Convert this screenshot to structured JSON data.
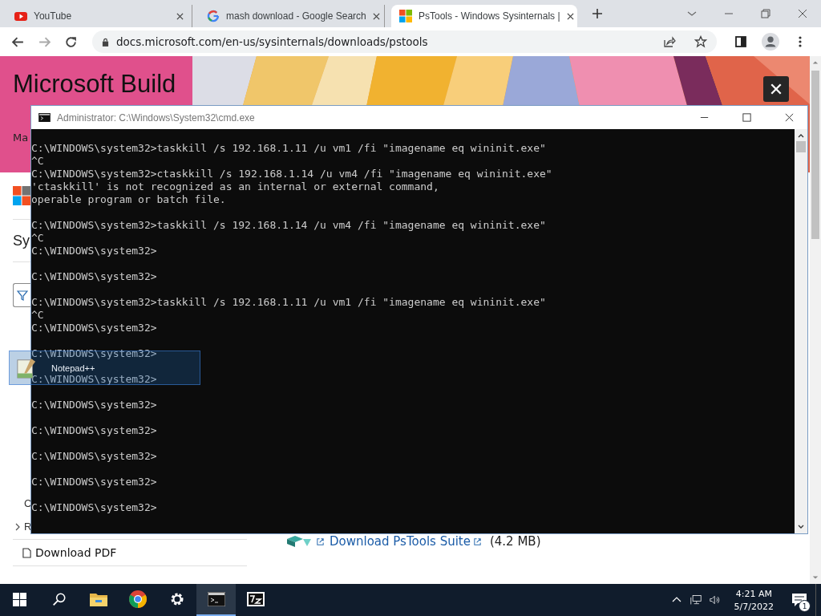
{
  "browser": {
    "tabs": [
      {
        "title": "YouTube",
        "kind": "video",
        "selected": false
      },
      {
        "title": "mash download - Google Search",
        "kind": "search",
        "selected": false
      },
      {
        "title": "PsTools - Windows Sysinternals |",
        "kind": "docs",
        "selected": true
      }
    ],
    "url": "docs.microsoft.com/en-us/sysinternals/downloads/pstools"
  },
  "page": {
    "banner": {
      "title": "Microsoft Build",
      "subtitle": "Ma"
    },
    "sidebar": {
      "heading": "Sy",
      "items": [
        {
          "label": "C",
          "kind": "plain"
        },
        {
          "label": "R",
          "kind": "expandable"
        }
      ],
      "pdf_link": "Download PDF"
    },
    "download": {
      "link": "Download PsTools Suite",
      "size": "(4.2 MB)"
    }
  },
  "console": {
    "title": "Administrator: C:\\Windows\\System32\\cmd.exe",
    "blocks": [
      [
        "C:\\WINDOWS\\system32>taskkill /s 192.168.1.11 /u vm1 /fi \"imagename eq wininit.exe\"",
        "^C",
        "C:\\WINDOWS\\system32>ctaskkill /s 192.168.1.14 /u vm4 /fi \"imagename eq wininit.exe\"",
        "'ctaskkill' is not recognized as an internal or external command,",
        "operable program or batch file."
      ],
      [
        "C:\\WINDOWS\\system32>taskkill /s 192.168.1.14 /u vm4 /fi \"imagename eq wininit.exe\"",
        "^C",
        "C:\\WINDOWS\\system32>"
      ],
      [
        "C:\\WINDOWS\\system32>"
      ],
      [
        "C:\\WINDOWS\\system32>taskkill /s 192.168.1.11 /u vm1 /fi \"imagename eq wininit.exe\"",
        "^C",
        "C:\\WINDOWS\\system32>"
      ],
      [
        "C:\\WINDOWS\\system32>"
      ],
      [
        "C:\\WINDOWS\\system32>"
      ],
      [
        "C:\\WINDOWS\\system32>"
      ],
      [
        "C:\\WINDOWS\\system32>"
      ],
      [
        "C:\\WINDOWS\\system32>"
      ],
      [
        "C:\\WINDOWS\\system32>"
      ],
      [
        "C:\\WINDOWS\\system32>"
      ]
    ]
  },
  "drag_item": {
    "label": "Notepad++"
  },
  "taskbar": {
    "items": [
      {
        "kind": "start",
        "active": false
      },
      {
        "kind": "search",
        "active": false
      },
      {
        "kind": "folder",
        "active": false
      },
      {
        "kind": "chrome",
        "active": false
      },
      {
        "kind": "settings",
        "active": false
      },
      {
        "kind": "console",
        "active": true
      },
      {
        "kind": "archiver",
        "active": false
      }
    ],
    "time": "4:21 AM",
    "date": "5/7/2022",
    "notifications": "1"
  }
}
